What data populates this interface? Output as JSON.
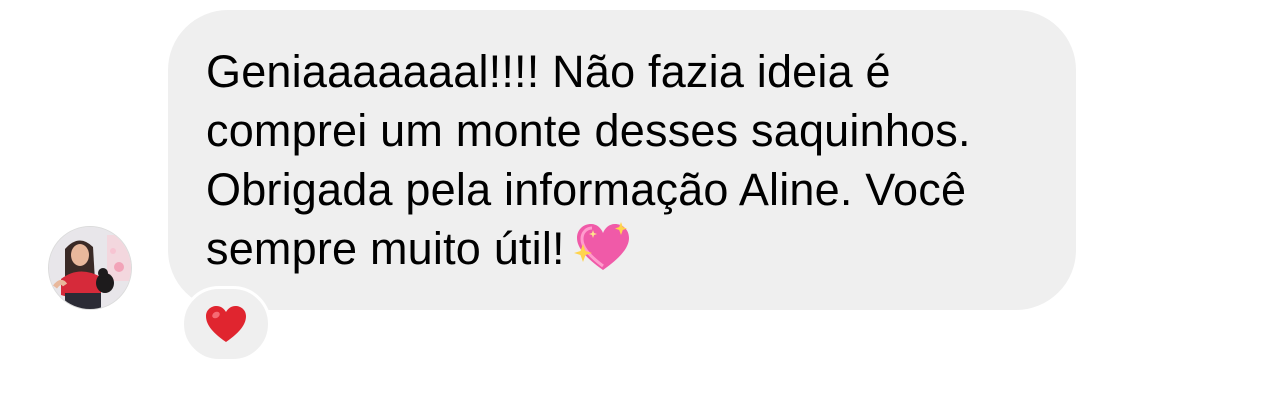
{
  "message": {
    "lines": [
      "Geniaaaaaaal!!!! Não fazia ideia é",
      "comprei um monte desses saquinhos.",
      "Obrigada pela informação Aline. Você",
      "sempre muito útil!"
    ],
    "trailing_emoji": "sparkling-heart"
  },
  "reaction": {
    "emoji": "red-heart"
  },
  "avatar": {
    "alt": "sender-avatar"
  },
  "colors": {
    "bubble": "#efefef",
    "text": "#000000",
    "heart_red": "#e0252f",
    "sparkle_heart_pink": "#f05aa8",
    "sparkle_yellow": "#ffd44d"
  }
}
